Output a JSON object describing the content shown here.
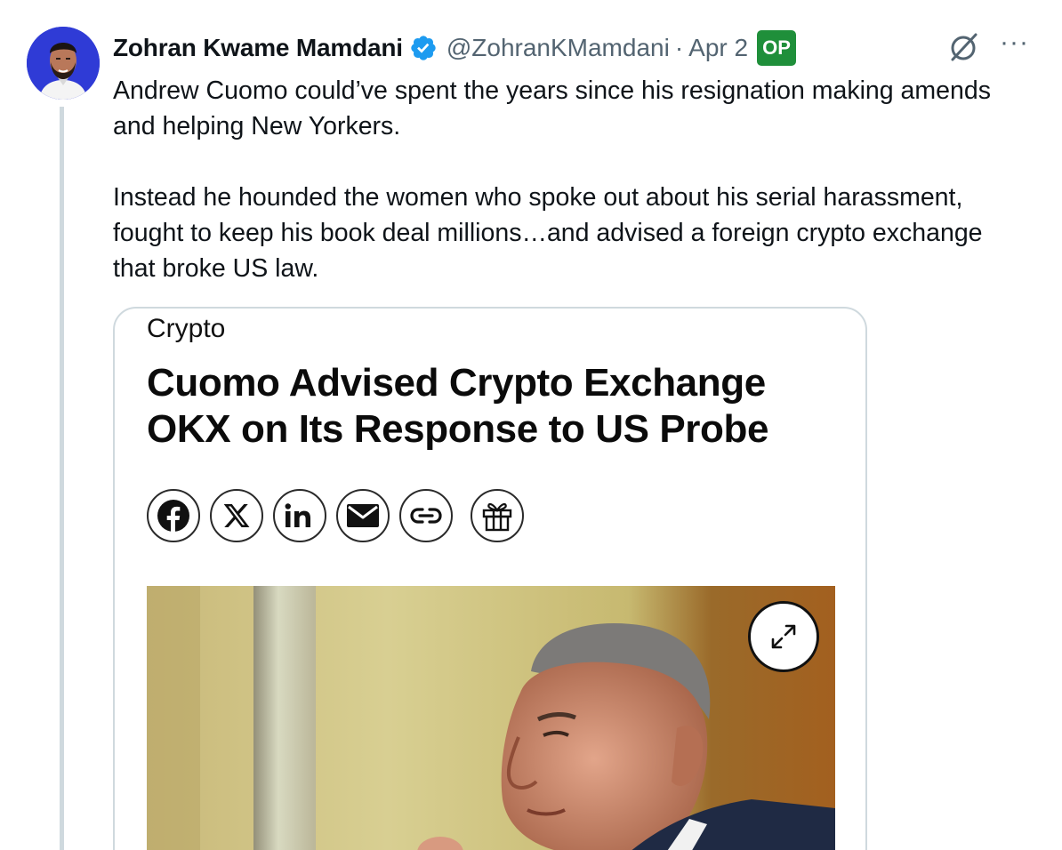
{
  "tweet": {
    "author_name": "Zohran Kwame Mamdani",
    "handle": "@ZohranKMamdani",
    "separator": "·",
    "date": "Apr 2",
    "op_badge": "OP",
    "more_label": "···",
    "paragraphs": [
      "Andrew Cuomo could’ve spent the years since his resignation making amends and helping New Yorkers.",
      "Instead he hounded the women who spoke out about his serial harassment, fought to keep his book deal millions…and advised a foreign crypto exchange that broke US law."
    ]
  },
  "card": {
    "category": "Crypto",
    "headline": "Cuomo Advised Crypto Exchange OKX on Its Response to US Probe",
    "share_icons": [
      "facebook-icon",
      "x-icon",
      "linkedin-icon",
      "email-icon",
      "link-icon",
      "gift-icon"
    ],
    "expand_icon": "expand-icon"
  },
  "colors": {
    "verified": "#1d9bf0",
    "op_badge": "#1f8f3a",
    "avatar_bg": "#2f3bd6",
    "secondary_text": "#536471",
    "border": "#cfd9de"
  }
}
